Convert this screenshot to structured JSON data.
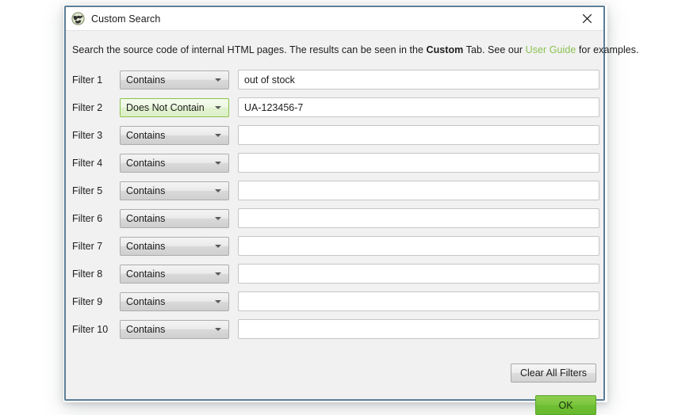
{
  "window": {
    "title": "Custom Search",
    "icon": "app-globe-icon",
    "close_icon": "close-icon",
    "border_color": "#5b7d96",
    "body_bg": "#f1f1f1",
    "titlebar_bg": "#ffffff"
  },
  "description": {
    "part1": "Search the source code of internal HTML pages. The results can be seen in the ",
    "bold": "Custom",
    "part2": " Tab. See our ",
    "link": "User Guide",
    "part3": " for examples.",
    "link_color": "#8cc152"
  },
  "filters": [
    {
      "label": "Filter 1",
      "condition": "Contains",
      "value": "out of stock",
      "selected": false
    },
    {
      "label": "Filter 2",
      "condition": "Does Not Contain",
      "value": "UA-123456-7",
      "selected": true
    },
    {
      "label": "Filter 3",
      "condition": "Contains",
      "value": "",
      "selected": false
    },
    {
      "label": "Filter 4",
      "condition": "Contains",
      "value": "",
      "selected": false
    },
    {
      "label": "Filter 5",
      "condition": "Contains",
      "value": "",
      "selected": false
    },
    {
      "label": "Filter 6",
      "condition": "Contains",
      "value": "",
      "selected": false
    },
    {
      "label": "Filter 7",
      "condition": "Contains",
      "value": "",
      "selected": false
    },
    {
      "label": "Filter 8",
      "condition": "Contains",
      "value": "",
      "selected": false
    },
    {
      "label": "Filter 9",
      "condition": "Contains",
      "value": "",
      "selected": false
    },
    {
      "label": "Filter 10",
      "condition": "Contains",
      "value": "",
      "selected": false
    }
  ],
  "condition_options": [
    "Contains",
    "Does Not Contain"
  ],
  "buttons": {
    "clear_all": "Clear All Filters",
    "ok": "OK",
    "ok_color": "#7cc63f"
  }
}
